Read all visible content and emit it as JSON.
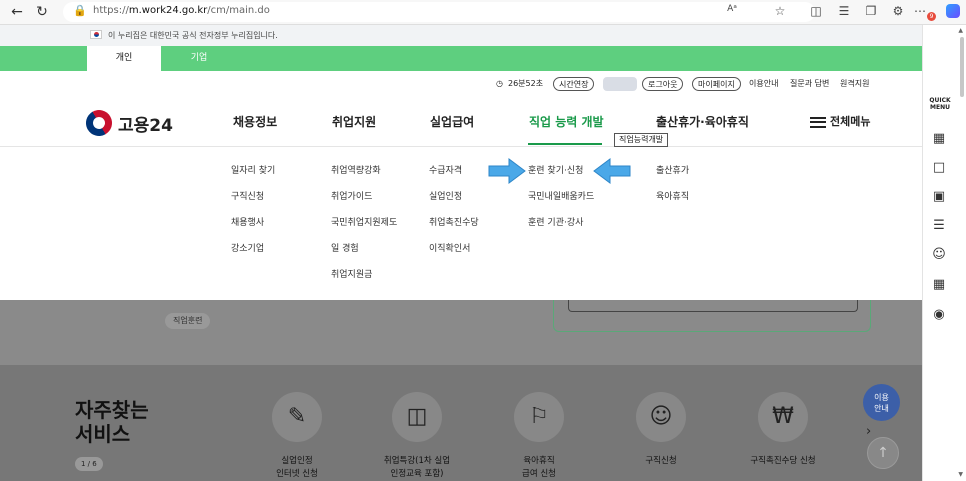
{
  "browser": {
    "url_prefix": "https://",
    "url_host": "m.work24.go.kr",
    "url_path": "/cm/main.do",
    "reader_label": "Aᵃ",
    "notification_count": "9"
  },
  "gov_banner": {
    "text": "이 누리집은 대한민국 공식 전자정부 누리집입니다."
  },
  "tabs": [
    {
      "label": "개인"
    },
    {
      "label": "기업"
    }
  ],
  "utility": {
    "timer": "26분52초",
    "extend": "시간연장",
    "user": "████",
    "logout": "로그아웃",
    "mypage": "마이페이지",
    "guide": "이용안내",
    "qa": "질문과 답변",
    "remote": "원격지원"
  },
  "logo": {
    "text": "고용24"
  },
  "gnb": [
    {
      "label": "채용정보"
    },
    {
      "label": "취업지원"
    },
    {
      "label": "실업급여"
    },
    {
      "label": "직업 능력 개발"
    },
    {
      "label": "출산휴가·육아휴직"
    }
  ],
  "allmenu": {
    "label": "전체메뉴"
  },
  "tooltip": {
    "text": "직업능력개발"
  },
  "mega": {
    "col1": [
      "일자리 찾기",
      "구직신청",
      "채용행사",
      "강소기업"
    ],
    "col2": [
      "취업역량강화",
      "취업가이드",
      "국민취업지원제도",
      "일 경험",
      "취업지원금"
    ],
    "col3": [
      "수급자격",
      "실업인정",
      "취업촉진수당",
      "이직확인서"
    ],
    "col4": [
      "훈련 찾기·신청",
      "국민내일배움카드",
      "훈련 기관·강사"
    ],
    "col5": [
      "출산휴가",
      "육아휴직"
    ]
  },
  "behind": {
    "chip": "직업훈련"
  },
  "services": {
    "title_1": "자주찾는",
    "title_2": "서비스",
    "page": "1 / 6",
    "items": [
      {
        "line1": "실업인정",
        "line2": "인터넷 신청"
      },
      {
        "line1": "취업특강(1차 실업",
        "line2": "인정교육 포함)"
      },
      {
        "line1": "육아휴직",
        "line2": "급여 신청"
      },
      {
        "line1": "구직신청",
        "line2": ""
      },
      {
        "line1": "구직촉진수당 신청",
        "line2": ""
      }
    ],
    "help_1": "이용",
    "help_2": "안내"
  },
  "sidebar": {
    "quick_1": "QUICK",
    "quick_2": "MENU"
  },
  "colors": {
    "green": "#5ecf7f",
    "active_green": "#1a9a4a",
    "arrow_blue": "#4aa8e8",
    "help_blue": "#3c5fa8"
  },
  "icons": [
    "back-icon",
    "refresh-icon",
    "lock-icon",
    "star-icon",
    "split-icon",
    "favorites-icon",
    "collections-icon",
    "extensions-icon",
    "more-icon",
    "copilot-icon",
    "building-icon",
    "chat-icon",
    "monitor-icon",
    "checklist-icon",
    "smile-icon",
    "calculator-icon",
    "coin-icon",
    "arrow-up-icon"
  ]
}
